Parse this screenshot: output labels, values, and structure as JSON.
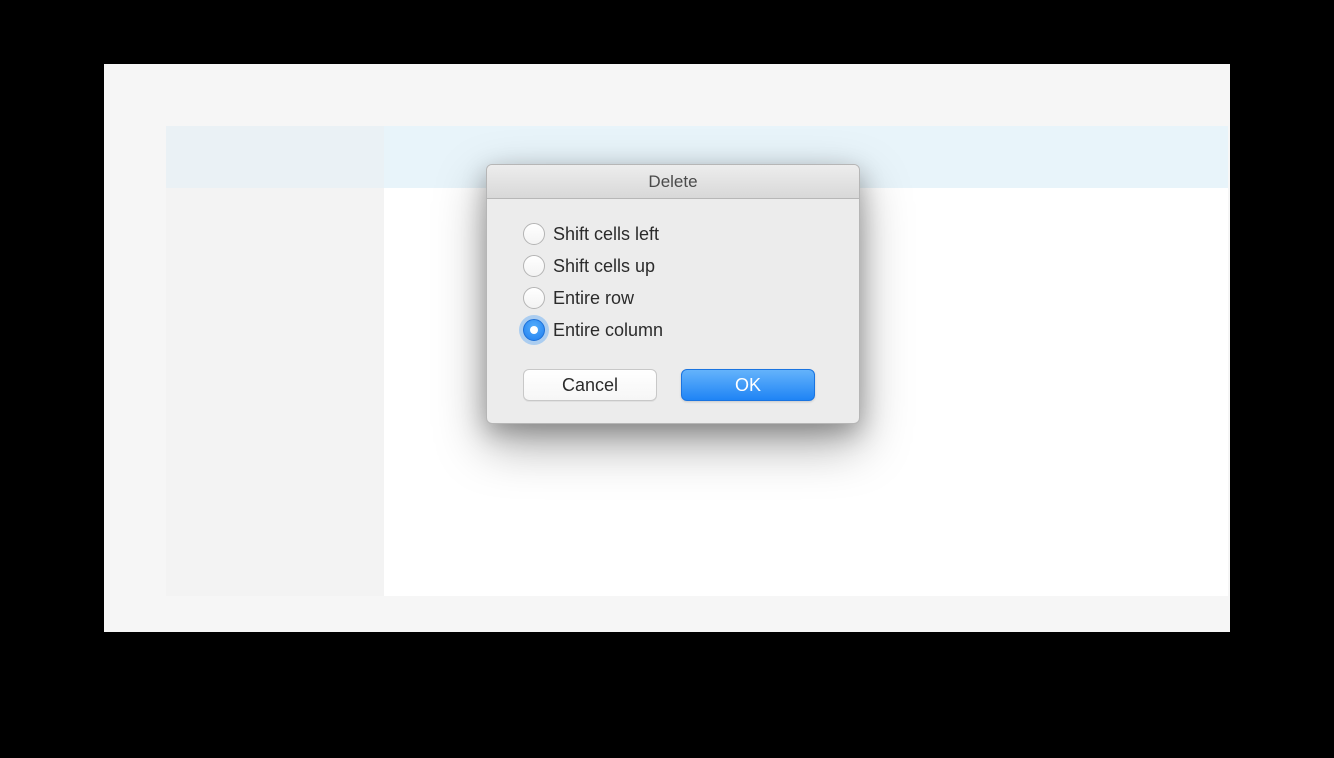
{
  "dialog": {
    "title": "Delete",
    "options": [
      {
        "label": "Shift cells left",
        "selected": false
      },
      {
        "label": "Shift cells up",
        "selected": false
      },
      {
        "label": "Entire row",
        "selected": false
      },
      {
        "label": "Entire column",
        "selected": true
      }
    ],
    "buttons": {
      "cancel": "Cancel",
      "ok": "OK"
    }
  }
}
